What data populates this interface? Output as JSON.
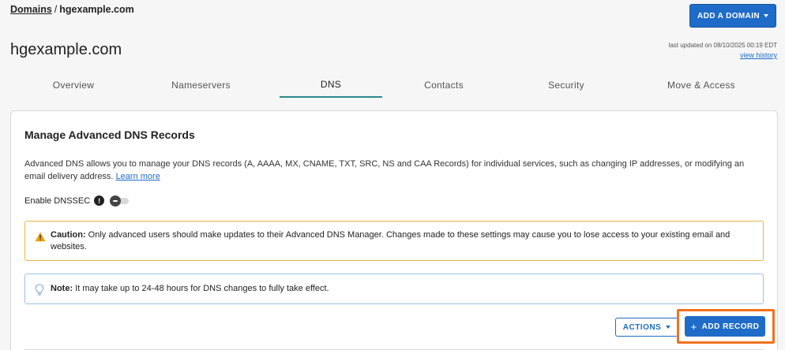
{
  "breadcrumb": {
    "root": "Domains",
    "separator": "/",
    "current": "hgexample.com"
  },
  "header": {
    "add_domain_label": "ADD A DOMAIN",
    "title": "hgexample.com"
  },
  "history": {
    "last_updated": "last updated on 08/10/2025 00:19 EDT",
    "view_history": "view history"
  },
  "tabs": [
    {
      "label": "Overview",
      "active": false
    },
    {
      "label": "Nameservers",
      "active": false
    },
    {
      "label": "DNS",
      "active": true
    },
    {
      "label": "Contacts",
      "active": false
    },
    {
      "label": "Security",
      "active": false
    },
    {
      "label": "Move & Access",
      "active": false
    }
  ],
  "panel": {
    "title": "Manage Advanced DNS Records",
    "description": "Advanced DNS allows you to manage your DNS records (A, AAAA, MX, CNAME, TXT, SRC, NS and CAA Records) for individual services, such as changing IP addresses, or modifying an email delivery address.",
    "learn_more": "Learn more",
    "dnssec_label": "Enable DNSSEC",
    "dnssec_info_glyph": "!",
    "dnssec_enabled": false,
    "caution_label": "Caution:",
    "caution_text": "Only advanced users should make updates to their Advanced DNS Manager. Changes made to these settings may cause you to lose access to your existing email and websites.",
    "note_label": "Note:",
    "note_text": "It may take up to 24-48 hours for DNS changes to fully take effect.",
    "actions_label": "ACTIONS",
    "add_record_plus": "+",
    "add_record_label": "ADD RECORD"
  },
  "colors": {
    "primary": "#1e6cc7",
    "tab_active": "#2b8a8b",
    "caution_border": "#e8b440",
    "note_border": "#9cc0e5",
    "highlight": "#f2711c"
  },
  "icons": {
    "caution": "warning-triangle-icon",
    "note": "lightbulb-icon",
    "dnssec_info": "info-icon"
  }
}
